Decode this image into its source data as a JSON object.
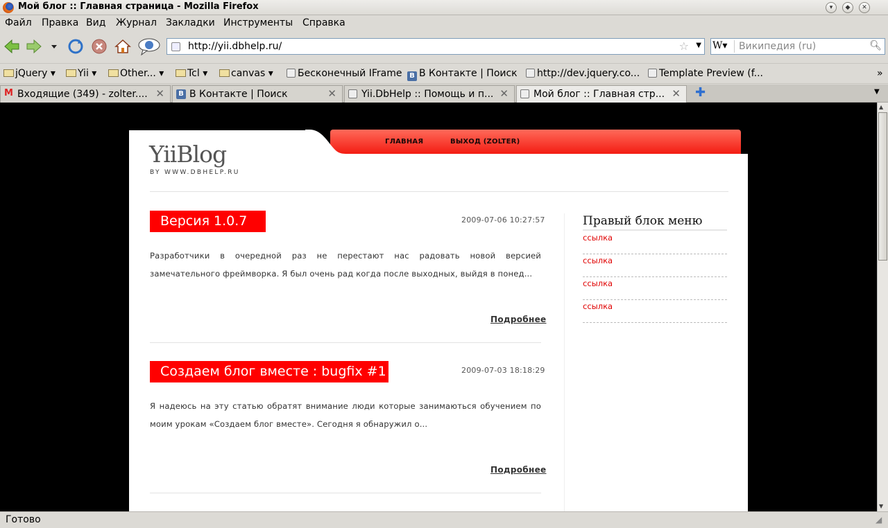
{
  "window": {
    "title": "Мой блог :: Главная страница - Mozilla Firefox"
  },
  "menu": [
    "Файл",
    "Правка",
    "Вид",
    "Журнал",
    "Закладки",
    "Инструменты",
    "Справка"
  ],
  "url": "http://yii.dbhelp.ru/",
  "search": {
    "engine": "W",
    "placeholder": "Википедия (ru)"
  },
  "bookmarks": [
    "jQuery",
    "Yii",
    "Other...",
    "Tcl",
    "canvas",
    "Бесконечный IFrame",
    "В Контакте | Поиск",
    "http://dev.jquery.co...",
    "Template Preview (f..."
  ],
  "tabs": [
    {
      "label": "Входящие (349) - zolter...."
    },
    {
      "label": "В Контакте | Поиск"
    },
    {
      "label": "Yii.DbHelp :: Помощь и п..."
    },
    {
      "label": "Мой блог :: Главная стр..."
    }
  ],
  "status": "Готово",
  "blog": {
    "logo": "YiiBlog",
    "logo_sub": "BY WWW.DBHELP.RU",
    "nav": [
      "ГЛАВНАЯ",
      "ВЫХОД (ZOLTER)"
    ],
    "posts": [
      {
        "title": "Версия 1.0.7",
        "date": "2009-07-06 10:27:57",
        "excerpt": "Разработчики в очередной раз не перестают нас радовать новой версией замечательного фреймворка. Я был очень рад когда после выходных, выйдя в понед...",
        "more": "Подробнее"
      },
      {
        "title": "Создаем блог вместе : bugfix #1",
        "date": "2009-07-03 18:18:29",
        "excerpt": "Я надеюсь на эту статью обратят внимание люди которые занимаються обучением по моим урокам «Создаем блог вместе». Сегодня я обнаружил о...",
        "more": "Подробнее"
      }
    ],
    "sidebar": {
      "title": "Правый блок меню",
      "links": [
        "ссылка",
        "ссылка",
        "ссылка",
        "ссылка"
      ]
    }
  },
  "colors": {
    "accent": "#ff0000",
    "link": "#e00000"
  }
}
